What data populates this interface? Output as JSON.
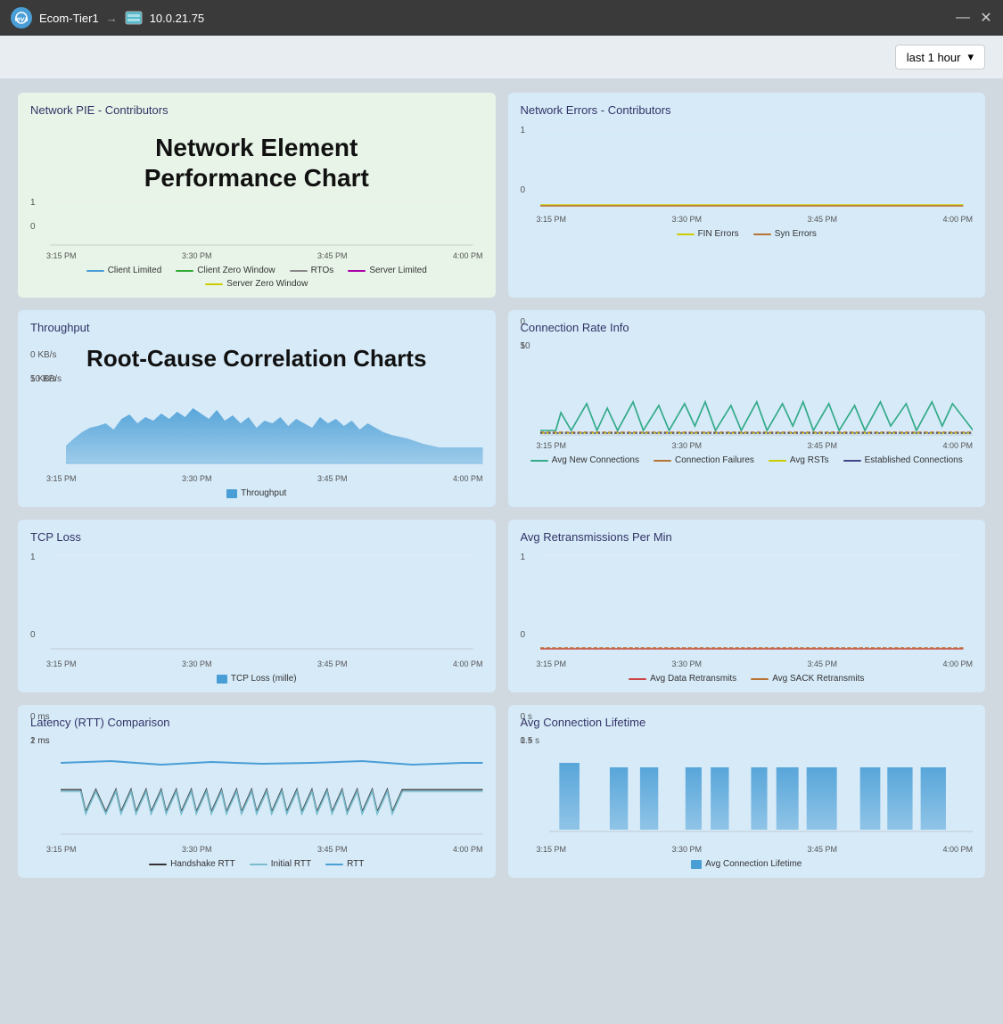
{
  "titlebar": {
    "app_name": "Ecom-Tier1",
    "server": "10.0.21.75",
    "minimize": "—",
    "close": "✕"
  },
  "toolbar": {
    "time_selector_label": "last 1 hour",
    "chevron": "▾"
  },
  "overlay_texts": {
    "pie_chart_overlay": "Network Element\nPerformance Chart",
    "throughput_overlay": "Root-Cause Correlation Charts"
  },
  "charts": {
    "network_pie": {
      "title": "Network PIE - Contributors",
      "y_top": "1",
      "y_bottom": "0",
      "x_labels": [
        "3:15 PM",
        "3:30 PM",
        "3:45 PM",
        "4:00 PM"
      ],
      "legend": [
        {
          "label": "Client Limited",
          "color": "#4a9ed6"
        },
        {
          "label": "Client Zero Window",
          "color": "#3a3"
        },
        {
          "label": "RTOs",
          "color": "#888"
        },
        {
          "label": "Server Limited",
          "color": "#a0a"
        },
        {
          "label": "Server Zero Window",
          "color": "#cc0"
        }
      ]
    },
    "network_errors": {
      "title": "Network Errors - Contributors",
      "y_top": "1",
      "y_bottom": "0",
      "x_labels": [
        "3:15 PM",
        "3:30 PM",
        "3:45 PM",
        "4:00 PM"
      ],
      "legend": [
        {
          "label": "FIN Errors",
          "color": "#cc0"
        },
        {
          "label": "Syn Errors",
          "color": "#b87333"
        }
      ]
    },
    "throughput": {
      "title": "Throughput",
      "y_labels": [
        "10 KB/s",
        "5 KB/s",
        "0 KB/s"
      ],
      "x_labels": [
        "3:15 PM",
        "3:30 PM",
        "3:45 PM",
        "4:00 PM"
      ],
      "legend": [
        {
          "label": "Throughput",
          "color": "#4a9ed6"
        }
      ]
    },
    "connection_rate": {
      "title": "Connection Rate Info",
      "y_top": "10",
      "y_mid": "5",
      "y_bottom": "0",
      "x_labels": [
        "3:15 PM",
        "3:30 PM",
        "3:45 PM",
        "4:00 PM"
      ],
      "legend": [
        {
          "label": "Avg New Connections",
          "color": "#3a8"
        },
        {
          "label": "Connection Failures",
          "color": "#b87333"
        },
        {
          "label": "Avg RSTs",
          "color": "#cc0"
        },
        {
          "label": "Established Connections",
          "color": "#448"
        }
      ]
    },
    "tcp_loss": {
      "title": "TCP Loss",
      "y_top": "1",
      "y_bottom": "0",
      "x_labels": [
        "3:15 PM",
        "3:30 PM",
        "3:45 PM",
        "4:00 PM"
      ],
      "legend": [
        {
          "label": "TCP Loss (mille)",
          "color": "#4a9ed6"
        }
      ]
    },
    "avg_retransmissions": {
      "title": "Avg Retransmissions Per Min",
      "y_top": "1",
      "y_bottom": "0",
      "x_labels": [
        "3:15 PM",
        "3:30 PM",
        "3:45 PM",
        "4:00 PM"
      ],
      "legend": [
        {
          "label": "Avg Data Retransmits",
          "color": "#c44"
        },
        {
          "label": "Avg SACK Retransmits",
          "color": "#b87333"
        }
      ]
    },
    "latency": {
      "title": "Latency (RTT) Comparison",
      "y_top": "2 ms",
      "y_mid": "1 ms",
      "y_bottom": "0 ms",
      "x_labels": [
        "3:15 PM",
        "3:30 PM",
        "3:45 PM",
        "4:00 PM"
      ],
      "legend": [
        {
          "label": "Handshake RTT",
          "color": "#333"
        },
        {
          "label": "Initial RTT",
          "color": "#7bc"
        },
        {
          "label": "RTT",
          "color": "#4a9ed6"
        }
      ]
    },
    "avg_connection_lifetime": {
      "title": "Avg Connection Lifetime",
      "y_top": "1 s",
      "y_mid": "0.5 s",
      "y_bottom": "0 s",
      "x_labels": [
        "3:15 PM",
        "3:30 PM",
        "3:45 PM",
        "4:00 PM"
      ],
      "legend": [
        {
          "label": "Avg Connection Lifetime",
          "color": "#4a9ed6"
        }
      ]
    }
  }
}
